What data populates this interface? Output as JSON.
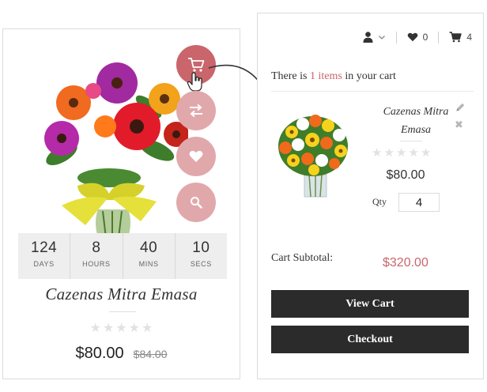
{
  "product": {
    "name": "Cazenas Mitra Emasa",
    "price": "$80.00",
    "old_price": "$84.00",
    "rating_stars": 5,
    "actions": [
      {
        "name": "add-to-cart",
        "icon": "cart-icon"
      },
      {
        "name": "compare",
        "icon": "compare-arrows-icon"
      },
      {
        "name": "wishlist",
        "icon": "heart-icon"
      },
      {
        "name": "quick-view",
        "icon": "search-icon"
      }
    ],
    "countdown": [
      {
        "value": "124",
        "label": "DAYS"
      },
      {
        "value": "8",
        "label": "HOURS"
      },
      {
        "value": "40",
        "label": "MINS"
      },
      {
        "value": "10",
        "label": "SECS"
      }
    ]
  },
  "header": {
    "account_icon": "user-icon",
    "wishlist_count": "0",
    "cart_count": "4"
  },
  "cart": {
    "message_prefix": "There is",
    "message_count": "1 items",
    "message_suffix": "in your cart",
    "item": {
      "name_line1": "Cazenas Mitra",
      "name_line2": "Emasa",
      "price": "$80.00",
      "qty_label": "Qty",
      "qty_value": "4"
    },
    "subtotal_label": "Cart Subtotal:",
    "subtotal_value": "$320.00",
    "view_cart_label": "View Cart",
    "checkout_label": "Checkout"
  },
  "colors": {
    "accent": "#c9656b",
    "button_light": "#e1a8ab",
    "button_dark": "#2b2b2b"
  }
}
